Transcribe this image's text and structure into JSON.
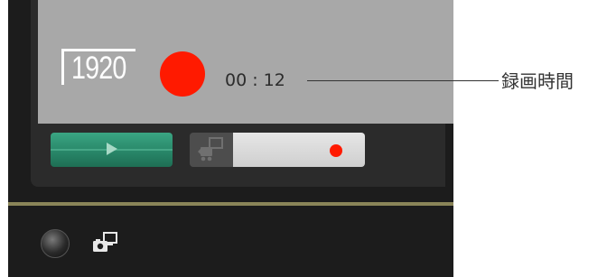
{
  "display": {
    "resolution": "1920",
    "rec_time": "00 : 12"
  },
  "callout": {
    "label": "録画時間"
  },
  "controls": {
    "play_icon": "play-triangle-icon",
    "mode_left_icon": "camera-monitor-icon",
    "mode_right_icon": "record-dot-icon"
  },
  "bottom": {
    "knob_icon": "black-knob-icon",
    "remote_icon": "camera-remote-icon"
  },
  "colors": {
    "record": "#ff1a00",
    "play": "#2a8a6b",
    "display_bg": "#a8a8a8"
  }
}
